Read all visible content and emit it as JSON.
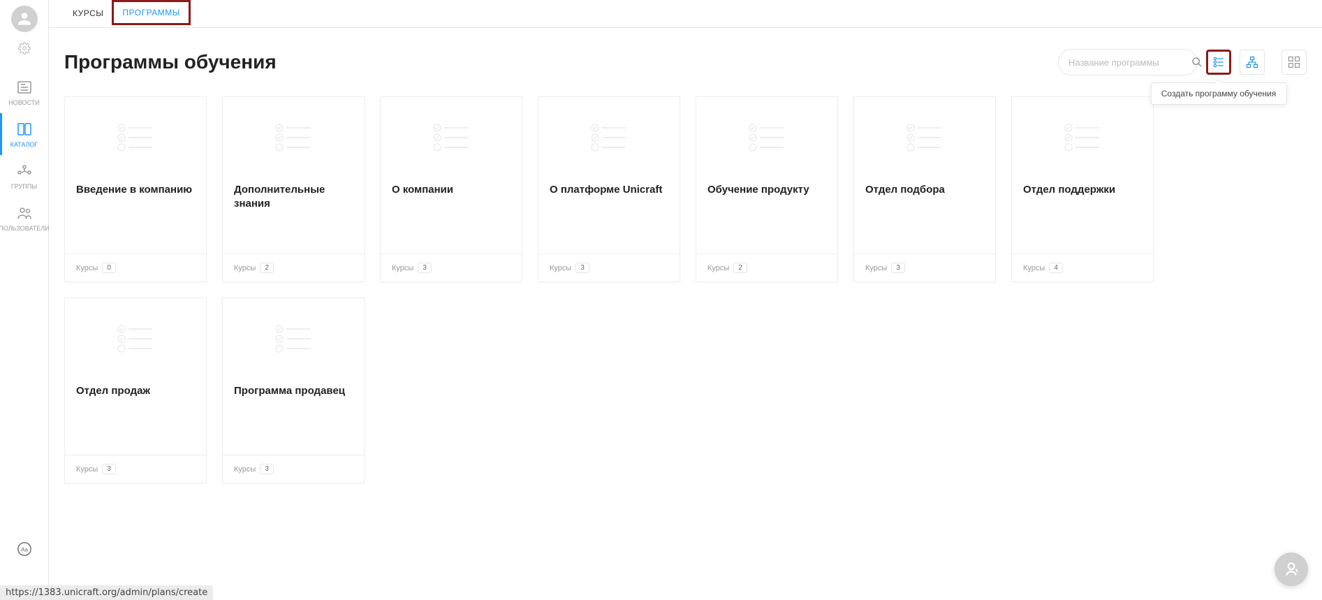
{
  "sidebar": {
    "items": [
      {
        "label": "НОВОСТИ"
      },
      {
        "label": "КАТАЛОГ"
      },
      {
        "label": "ГРУППЫ"
      },
      {
        "label": "ПОЛЬЗОВАТЕЛИ"
      }
    ]
  },
  "tabs": {
    "courses": "КУРСЫ",
    "programs": "ПРОГРАММЫ"
  },
  "page": {
    "title": "Программы обучения"
  },
  "search": {
    "placeholder": "Название программы"
  },
  "tooltip": {
    "create_program": "Создать программу обучения"
  },
  "cards": [
    {
      "title": "Введение в компанию",
      "courses_label": "Курсы",
      "count": "0"
    },
    {
      "title": "Дополнительные знания",
      "courses_label": "Курсы",
      "count": "2"
    },
    {
      "title": "О компании",
      "courses_label": "Курсы",
      "count": "3"
    },
    {
      "title": "О платформе Unicraft",
      "courses_label": "Курсы",
      "count": "3"
    },
    {
      "title": "Обучение продукту",
      "courses_label": "Курсы",
      "count": "2"
    },
    {
      "title": "Отдел подбора",
      "courses_label": "Курсы",
      "count": "3"
    },
    {
      "title": "Отдел поддержки",
      "courses_label": "Курсы",
      "count": "4"
    },
    {
      "title": "Отдел продаж",
      "courses_label": "Курсы",
      "count": "3"
    },
    {
      "title": "Программа продавец",
      "courses_label": "Курсы",
      "count": "3"
    }
  ],
  "status_url": "https://1383.unicraft.org/admin/plans/create"
}
